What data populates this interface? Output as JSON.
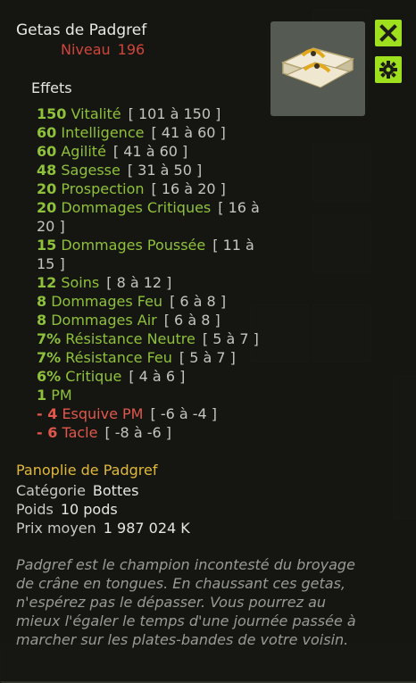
{
  "item": {
    "name": "Getas de Padgref",
    "level_label": "Niveau",
    "level_value": "196"
  },
  "buttons": {
    "close_icon": "close-icon",
    "settings_icon": "gear-icon"
  },
  "effects_title": "Effets",
  "effects": [
    {
      "value": "150",
      "name": "Vitalité",
      "range": "[ 101 à 150 ]",
      "negative": false
    },
    {
      "value": "60",
      "name": "Intelligence",
      "range": "[ 41 à 60 ]",
      "negative": false
    },
    {
      "value": "60",
      "name": "Agilité",
      "range": "[ 41 à 60 ]",
      "negative": false
    },
    {
      "value": "48",
      "name": "Sagesse",
      "range": "[ 31 à 50 ]",
      "negative": false
    },
    {
      "value": "20",
      "name": "Prospection",
      "range": "[ 16 à 20 ]",
      "negative": false
    },
    {
      "value": "20",
      "name": "Dommages Critiques",
      "range": "[ 16 à 20 ]",
      "negative": false
    },
    {
      "value": "15",
      "name": "Dommages Poussée",
      "range": "[ 11 à 15 ]",
      "negative": false
    },
    {
      "value": "12",
      "name": "Soins",
      "range": "[ 8 à 12 ]",
      "negative": false
    },
    {
      "value": "8",
      "name": "Dommages Feu",
      "range": "[ 6 à 8 ]",
      "negative": false
    },
    {
      "value": "8",
      "name": "Dommages Air",
      "range": "[ 6 à 8 ]",
      "negative": false
    },
    {
      "value": "7%",
      "name": "Résistance Neutre",
      "range": "[ 5 à 7 ]",
      "negative": false
    },
    {
      "value": "7%",
      "name": "Résistance Feu",
      "range": "[ 5 à 7 ]",
      "negative": false
    },
    {
      "value": "6%",
      "name": "Critique",
      "range": "[ 4 à 6 ]",
      "negative": false
    },
    {
      "value": "1",
      "name": "PM",
      "range": "",
      "negative": false
    },
    {
      "value": "- 4",
      "name": "Esquive PM",
      "range": "[ -6 à -4 ]",
      "negative": true
    },
    {
      "value": "- 6",
      "name": "Tacle",
      "range": "[ -8 à -6 ]",
      "negative": true
    }
  ],
  "set_name": "Panoplie de Padgref",
  "category": {
    "label": "Catégorie",
    "value": "Bottes"
  },
  "weight": {
    "label": "Poids",
    "value": "10 pods"
  },
  "price": {
    "label": "Prix moyen",
    "value": "1 987 024 K"
  },
  "description": "Padgref est le champion incontesté du broyage de crâne en tongues. En chaussant ces getas, n'espérez pas le dépasser. Vous pourrez au mieux l'égaler le temps d'une journée passée à marcher sur les plates-bandes de votre voisin.",
  "colors": {
    "accent": "#9ee01e",
    "effect_positive": "#8fc13a",
    "effect_negative": "#e2574b",
    "set": "#e0b93b",
    "level": "#d0453c"
  }
}
